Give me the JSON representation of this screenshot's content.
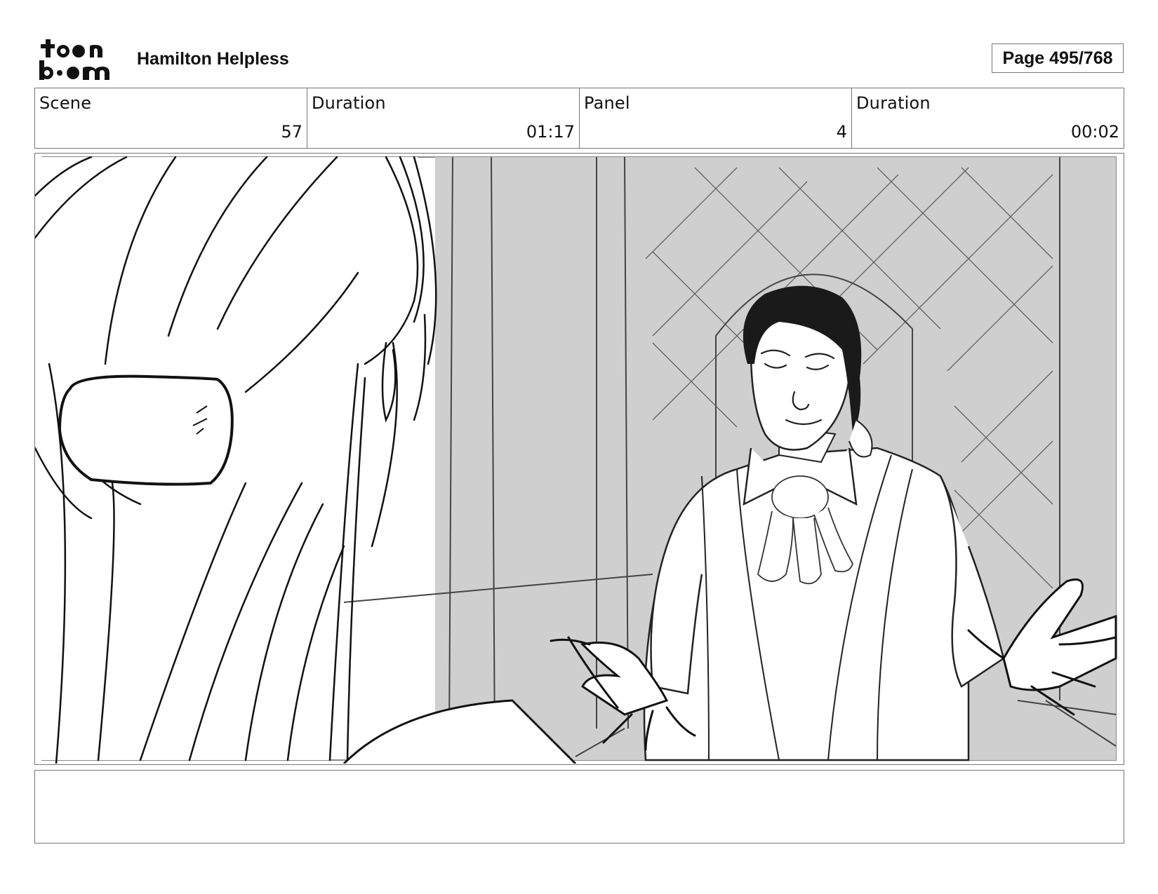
{
  "header": {
    "project_title": "Hamilton Helpless",
    "page_indicator": "Page 495/768"
  },
  "info": {
    "scene_label": "Scene",
    "scene_value": "57",
    "scene_duration_label": "Duration",
    "scene_duration_value": "01:17",
    "panel_label": "Panel",
    "panel_value": "4",
    "panel_duration_label": "Duration",
    "panel_duration_value": "00:02"
  },
  "caption": {
    "text": ""
  },
  "icons": {
    "logo": "toonboom-logo-icon"
  }
}
